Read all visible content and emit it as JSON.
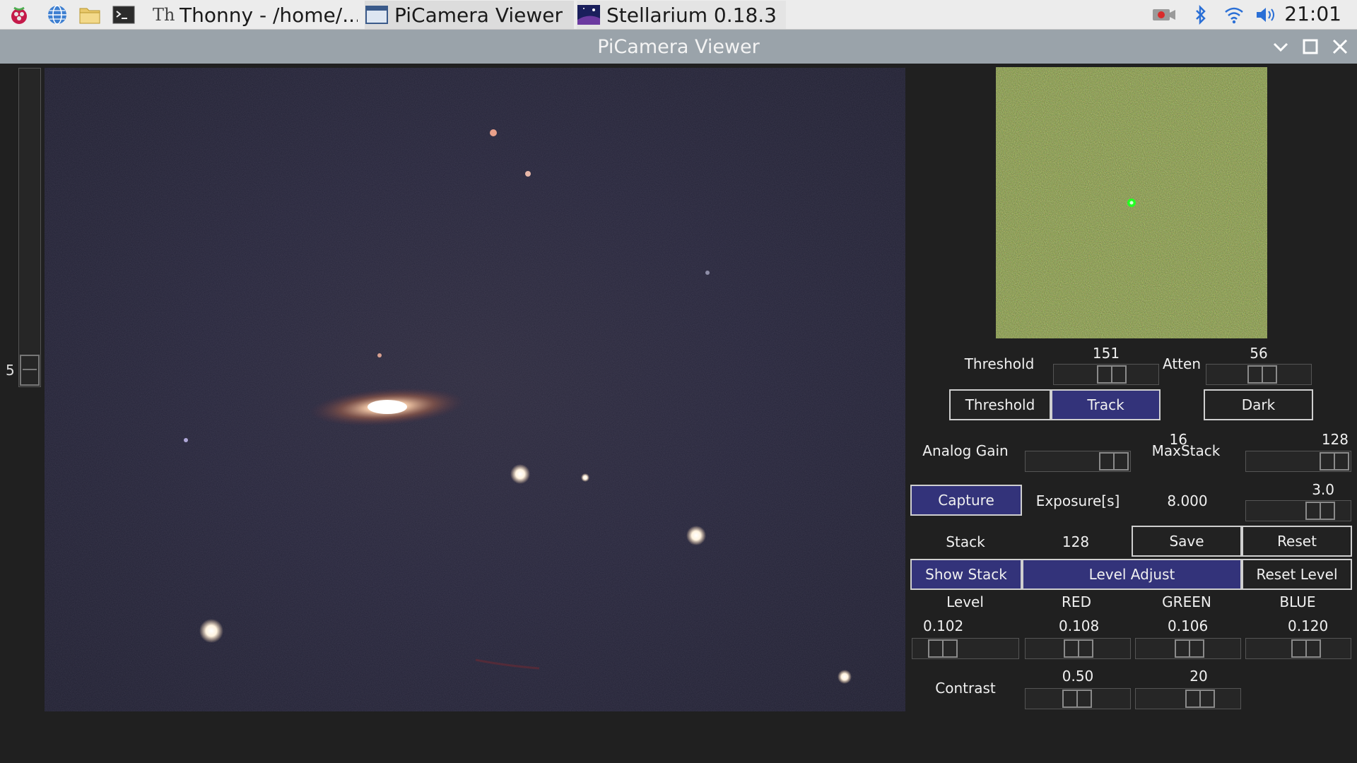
{
  "taskbar": {
    "apps": [
      {
        "icon": "thonny-icon",
        "label": "Thonny  -  /home/..."
      },
      {
        "icon": "window-icon",
        "label": "PiCamera Viewer"
      },
      {
        "icon": "stellarium-icon",
        "label": "Stellarium 0.18.3"
      }
    ],
    "clock": "21:01"
  },
  "window": {
    "title": "PiCamera Viewer"
  },
  "scale": {
    "label": "5"
  },
  "controls": {
    "threshold_label": "Threshold",
    "threshold_value": "151",
    "atten_label": "Atten",
    "atten_value": "56",
    "threshold_button": "Threshold",
    "track_button": "Track",
    "dark_button": "Dark",
    "analog_gain_label": "Analog Gain",
    "analog_gain_value": "16",
    "maxstack_label": "MaxStack",
    "maxstack_value": "128",
    "capture_button": "Capture",
    "exposure_label": "Exposure[s]",
    "exposure_value": "8.000",
    "exposure_slider_value": "3.0",
    "stack_label": "Stack",
    "stack_value": "128",
    "save_button": "Save",
    "reset_button": "Reset",
    "show_stack_button": "Show Stack",
    "level_adjust_button": "Level Adjust",
    "reset_level_button": "Reset Level",
    "level_header": "Level",
    "red_header": "RED",
    "green_header": "GREEN",
    "blue_header": "BLUE",
    "level_value": "0.102",
    "red_value": "0.108",
    "green_value": "0.106",
    "blue_value": "0.120",
    "contrast_label": "Contrast",
    "contrast_value_1": "0.50",
    "contrast_value_2": "20"
  },
  "colors": {
    "active_button": "#33337a",
    "title_bar": "#9aa3aa",
    "track_marker": "#22ff22"
  }
}
